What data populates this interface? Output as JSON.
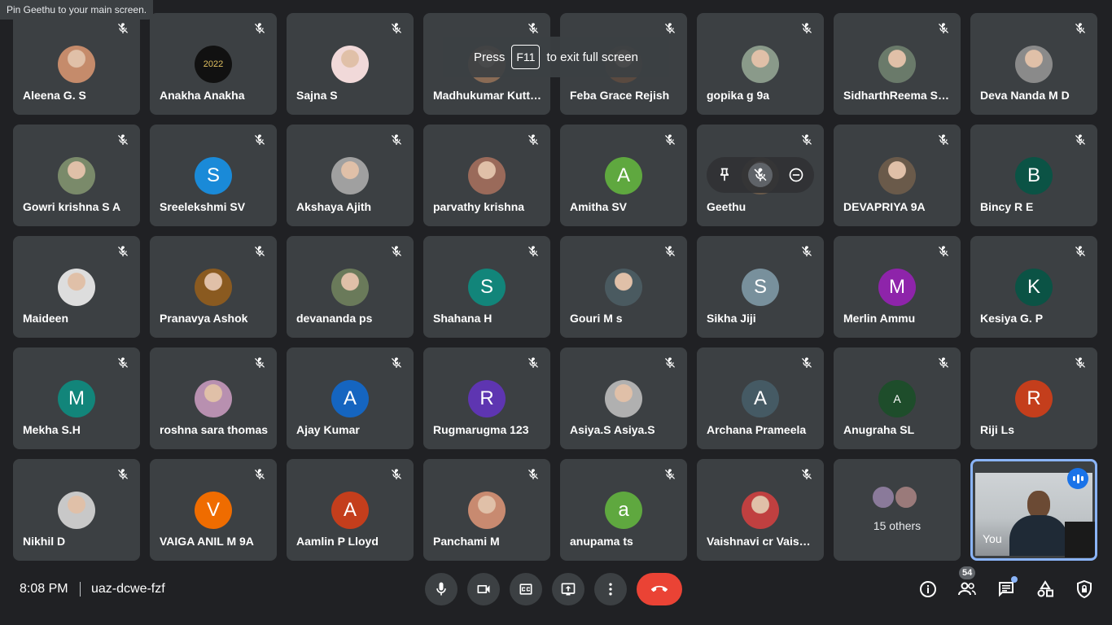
{
  "tooltip": "Pin Geethu to your main screen.",
  "fullscreen_hint": {
    "press": "Press",
    "key": "F11",
    "rest": "to exit full screen"
  },
  "participants": [
    {
      "name": "Aleena G. S",
      "avatar": "",
      "color": "#c58b6b",
      "photo": true
    },
    {
      "name": "Anakha Anakha",
      "avatar": "2022",
      "color": "#111111",
      "photo": false
    },
    {
      "name": "Sajna S",
      "avatar": "",
      "color": "#f1d9d9",
      "photo": true
    },
    {
      "name": "Madhukumar Kutt…",
      "avatar": "",
      "color": "#8a6b55",
      "photo": true
    },
    {
      "name": "Feba Grace Rejish",
      "avatar": "",
      "color": "#5a4a40",
      "photo": true
    },
    {
      "name": "gopika g 9a",
      "avatar": "",
      "color": "#8a9a8a",
      "photo": true
    },
    {
      "name": "SidharthReema Sa…",
      "avatar": "",
      "color": "#6a7a6a",
      "photo": true
    },
    {
      "name": "Deva Nanda M D",
      "avatar": "",
      "color": "#8a8a8a",
      "photo": true
    },
    {
      "name": "Gowri krishna S A",
      "avatar": "",
      "color": "#7a8a6a",
      "photo": true
    },
    {
      "name": "Sreelekshmi SV",
      "avatar": "S",
      "color": "#1a8ad8",
      "photo": false
    },
    {
      "name": "Akshaya Ajith",
      "avatar": "",
      "color": "#a0a0a0",
      "photo": true
    },
    {
      "name": "parvathy krishna",
      "avatar": "",
      "color": "#9a6a5a",
      "photo": true
    },
    {
      "name": "Amitha SV",
      "avatar": "A",
      "color": "#5fa83f",
      "photo": false
    },
    {
      "name": "Geethu",
      "avatar": "",
      "color": "#6a5a4a",
      "photo": true
    },
    {
      "name": "DEVAPRIYA 9A",
      "avatar": "",
      "color": "#6a5a4a",
      "photo": true
    },
    {
      "name": "Bincy R E",
      "avatar": "B",
      "color": "#0b5345",
      "photo": false
    },
    {
      "name": "Maideen",
      "avatar": "",
      "color": "#dddddd",
      "photo": true
    },
    {
      "name": "Pranavya Ashok",
      "avatar": "",
      "color": "#8a5a20",
      "photo": true
    },
    {
      "name": "devananda ps",
      "avatar": "",
      "color": "#6a7a5a",
      "photo": true
    },
    {
      "name": "Shahana H",
      "avatar": "S",
      "color": "#12857a",
      "photo": false
    },
    {
      "name": "Gouri M s",
      "avatar": "",
      "color": "#4a5a60",
      "photo": true
    },
    {
      "name": "Sikha Jiji",
      "avatar": "S",
      "color": "#78909c",
      "photo": false
    },
    {
      "name": "Merlin Ammu",
      "avatar": "M",
      "color": "#8e24aa",
      "photo": false
    },
    {
      "name": "Kesiya G. P",
      "avatar": "K",
      "color": "#0b5345",
      "photo": false
    },
    {
      "name": "Mekha S.H",
      "avatar": "M",
      "color": "#12857a",
      "photo": false
    },
    {
      "name": "roshna sara thomas",
      "avatar": "",
      "color": "#b890b0",
      "photo": true
    },
    {
      "name": "Ajay Kumar",
      "avatar": "A",
      "color": "#1565c0",
      "photo": false
    },
    {
      "name": "Rugmarugma 123",
      "avatar": "R",
      "color": "#5e35b1",
      "photo": false
    },
    {
      "name": "Asiya.S Asiya.S",
      "avatar": "",
      "color": "#b0b0b0",
      "photo": true
    },
    {
      "name": "Archana Prameela",
      "avatar": "A",
      "color": "#455a64",
      "photo": false
    },
    {
      "name": "Anugraha SL",
      "avatar": "A",
      "color": "#1e4d2b",
      "photo": false,
      "small": true
    },
    {
      "name": "Riji Ls",
      "avatar": "R",
      "color": "#c43e1c",
      "photo": false
    },
    {
      "name": "Nikhil D",
      "avatar": "",
      "color": "#c8c8c8",
      "photo": true
    },
    {
      "name": "VAIGA ANIL M 9A",
      "avatar": "V",
      "color": "#ef6c00",
      "photo": false
    },
    {
      "name": "Aamlin P Lloyd",
      "avatar": "A",
      "color": "#c43e1c",
      "photo": false
    },
    {
      "name": "Panchami M",
      "avatar": "",
      "color": "#c88a70",
      "photo": true
    },
    {
      "name": "anupama ts",
      "avatar": "a",
      "color": "#5fa83f",
      "photo": false
    },
    {
      "name": "Vaishnavi cr Vaish…",
      "avatar": "",
      "color": "#c04040",
      "photo": true
    }
  ],
  "others": {
    "label": "15 others"
  },
  "self": {
    "label": "You"
  },
  "bottom_bar": {
    "time": "8:08 PM",
    "meeting_code": "uaz-dcwe-fzf",
    "people_count": "54"
  },
  "colors": {
    "accent": "#8ab4f8",
    "end_call": "#ea4335",
    "tile_bg": "#3c4043",
    "page_bg": "#202124"
  }
}
